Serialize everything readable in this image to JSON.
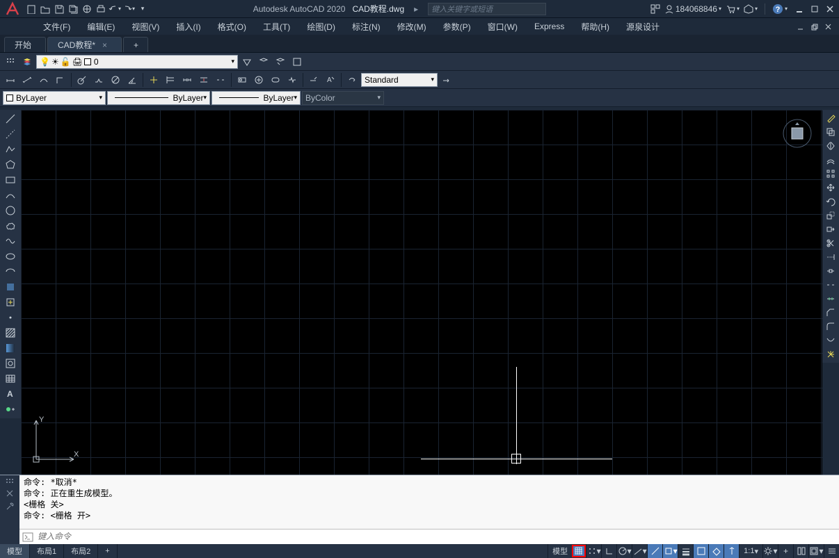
{
  "title": {
    "app": "Autodesk AutoCAD 2020",
    "file": "CAD教程.dwg"
  },
  "search_placeholder": "键入关键字或短语",
  "user_id": "184068846",
  "menus": [
    "文件(F)",
    "编辑(E)",
    "视图(V)",
    "插入(I)",
    "格式(O)",
    "工具(T)",
    "绘图(D)",
    "标注(N)",
    "修改(M)",
    "参数(P)",
    "窗口(W)",
    "Express",
    "帮助(H)",
    "源泉设计"
  ],
  "tabs": {
    "start": "开始",
    "active": "CAD教程*"
  },
  "layer_current": "0",
  "bylayer": "ByLayer",
  "bycolor": "ByColor",
  "textstyle": "Standard",
  "cmd_history": [
    "命令:  *取消*",
    "命令:  正在重生成模型。",
    "<栅格 关>",
    "命令:   <栅格 开>"
  ],
  "cmd_placeholder": "键入命令",
  "layouts": {
    "model": "模型",
    "l1": "布局1",
    "l2": "布局2"
  },
  "status": {
    "model_btn": "模型",
    "scale": "1:1"
  }
}
